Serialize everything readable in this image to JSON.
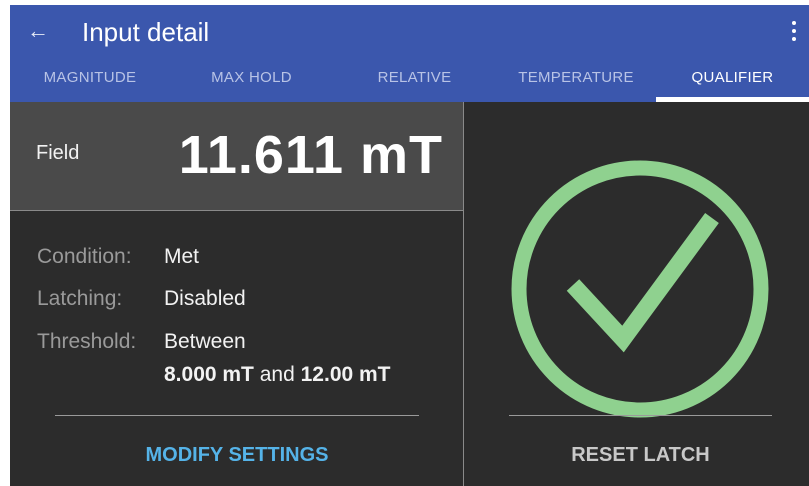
{
  "appbar": {
    "title": "Input detail"
  },
  "tabs": [
    {
      "label": "MAGNITUDE"
    },
    {
      "label": "MAX HOLD"
    },
    {
      "label": "RELATIVE"
    },
    {
      "label": "TEMPERATURE"
    },
    {
      "label": "QUALIFIER",
      "active": true
    }
  ],
  "field": {
    "label": "Field",
    "value": "11.611 mT"
  },
  "info": {
    "condition_label": "Condition:",
    "condition_value": "Met",
    "latching_label": "Latching:",
    "latching_value": "Disabled",
    "threshold_label": "Threshold:",
    "threshold_value": "Between",
    "threshold_low": "8.000 mT",
    "threshold_and": "and",
    "threshold_high": "12.00 mT"
  },
  "actions": {
    "modify_label": "MODIFY SETTINGS",
    "reset_label": "RESET LATCH"
  },
  "colors": {
    "appbar": "#3b57ad",
    "check": "#8fd18f",
    "accent_link": "#55b3e8",
    "background": "#2c2c2c"
  },
  "icons": {
    "back": "arrow-left-icon",
    "overflow": "more-vertical-icon",
    "status": "check-circle-icon"
  }
}
